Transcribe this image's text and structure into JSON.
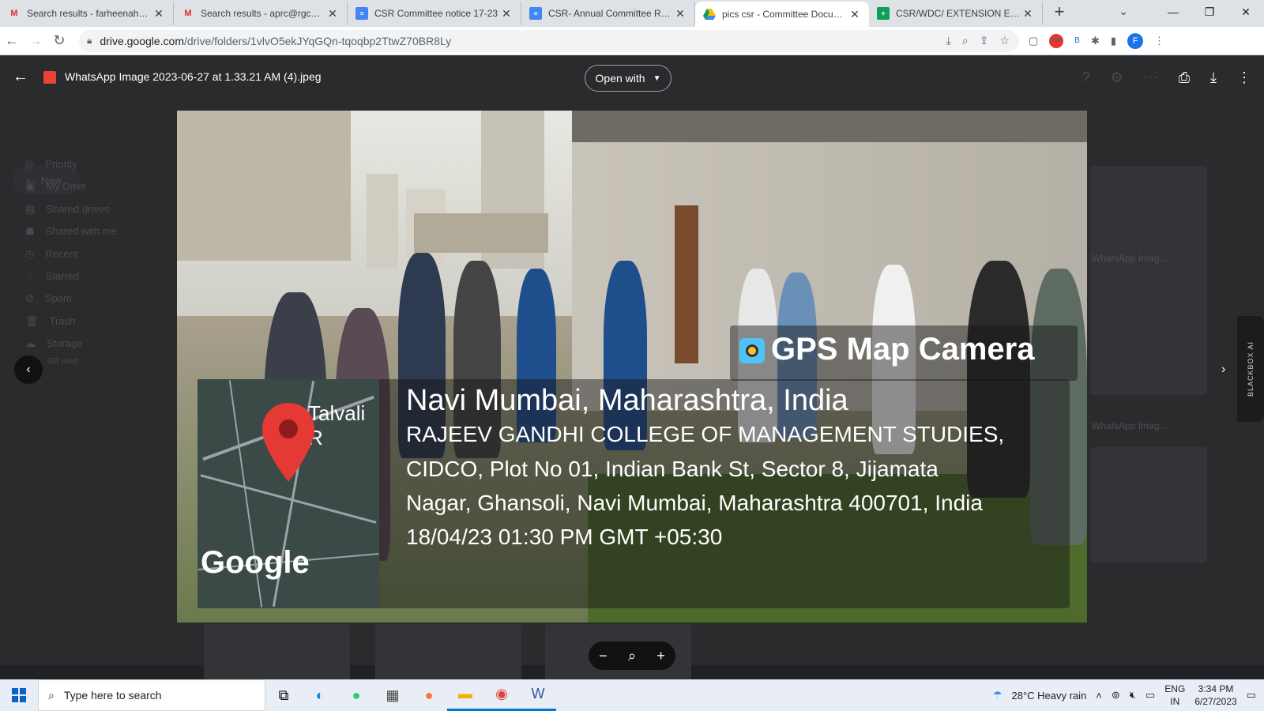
{
  "tabs": [
    {
      "label": "Search results - farheenahmad",
      "icon": "gmail-icon"
    },
    {
      "label": "Search results - aprc@rgcms.ac",
      "icon": "gmail-icon"
    },
    {
      "label": "CSR Committee notice 17-23",
      "icon": "docs-icon"
    },
    {
      "label": "CSR- Annual Committee Report",
      "icon": "docs-icon"
    },
    {
      "label": "pics csr - Committee Documents",
      "icon": "drive-icon"
    },
    {
      "label": "CSR/WDC/ EXTENSION EVENTS",
      "icon": "sheets-icon"
    }
  ],
  "address": {
    "host": "drive.google.com",
    "path": "/drive/folders/1vlvO5ekJYqGQn-tqoqbp2TtwZ70BR8Ly"
  },
  "viewer": {
    "filename": "WhatsApp Image 2023-06-27 at 1.33.21 AM (4).jpeg",
    "open_with": "Open with"
  },
  "drive_sidebar": {
    "new": "New",
    "items": [
      "Priority",
      "My Drive",
      "Shared drives",
      "Shared with me",
      "Recent",
      "Starred",
      "Spam",
      "Trash",
      "Storage"
    ],
    "storage_note": "GB used"
  },
  "drive_bg": {
    "card1": "WhatsApp Imag...",
    "card2": "WhatsApp Imag..."
  },
  "photo": {
    "gps_title": "GPS Map Camera",
    "map_label": "Talvali R",
    "google": "Google",
    "city": "Navi Mumbai, Maharashtra, India",
    "addr1": "RAJEEV GANDHI COLLEGE OF MANAGEMENT STUDIES,",
    "addr2": "CIDCO, Plot No 01, Indian Bank St, Sector 8, Jijamata",
    "addr3": "Nagar, Ghansoli, Navi Mumbai, Maharashtra 400701, India",
    "timestamp": "18/04/23 01:30 PM GMT +05:30"
  },
  "blackbox": "BLACKBOX AI",
  "taskbar": {
    "search_placeholder": "Type here to search",
    "weather": "28°C  Heavy rain",
    "lang1": "ENG",
    "lang2": "IN",
    "time": "3:34 PM",
    "date": "6/27/2023"
  }
}
